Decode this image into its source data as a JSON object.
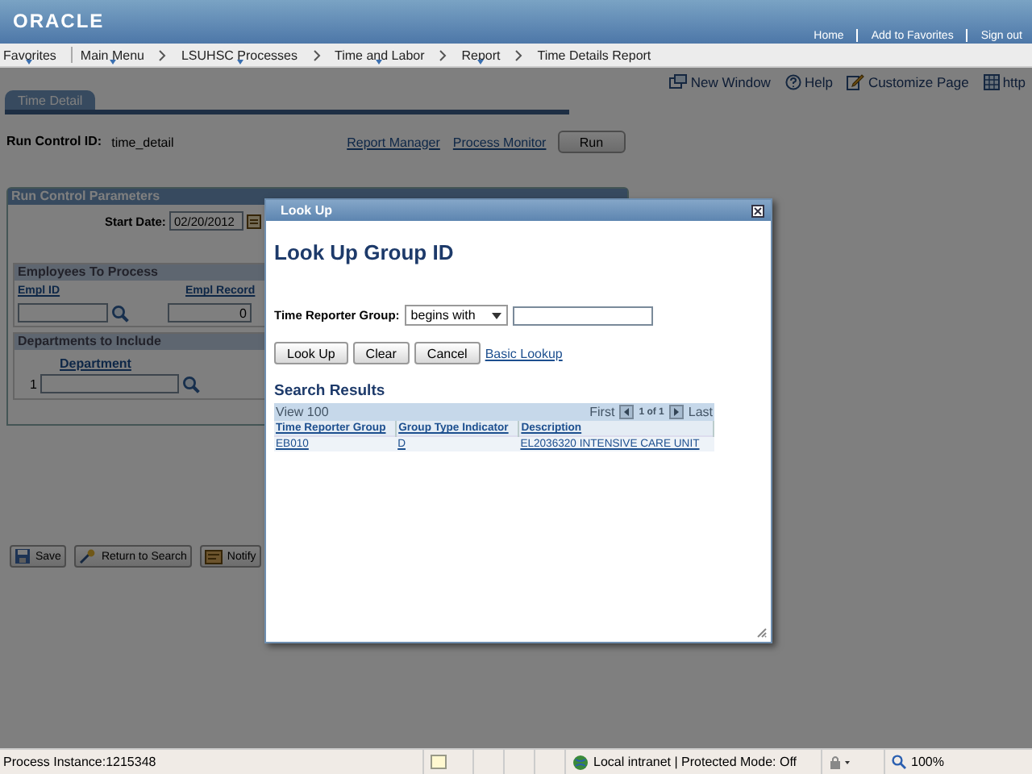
{
  "header": {
    "logo": "ORACLE",
    "links": [
      "Home",
      "Add to Favorites",
      "Sign out"
    ]
  },
  "breadcrumbs": [
    {
      "label": "Favorites",
      "menu": true
    },
    {
      "label": "Main Menu",
      "menu": true
    },
    {
      "label": "LSUHSC Processes",
      "menu": true
    },
    {
      "label": "Time and Labor",
      "menu": true
    },
    {
      "label": "Report",
      "menu": true
    },
    {
      "label": "Time Details Report",
      "menu": false
    }
  ],
  "page_toolbar": [
    {
      "kind": "new-window",
      "label": "New Window"
    },
    {
      "kind": "help",
      "label": "Help"
    },
    {
      "kind": "customize",
      "label": "Customize Page"
    },
    {
      "kind": "http",
      "label": "http"
    }
  ],
  "tabs": [
    {
      "label": "Time Detail",
      "selected": true
    }
  ],
  "run_control": {
    "label": "Run Control ID:",
    "value": "time_detail",
    "links": [
      "Report Manager",
      "Process Monitor"
    ],
    "button": "Run"
  },
  "parameters": {
    "title": "Run Control Parameters",
    "start_date": {
      "label": "Start Date:",
      "value": "02/20/2012"
    },
    "employees": {
      "title": "Employees To Process",
      "columns": [
        "Empl ID",
        "Empl Record"
      ],
      "empl_record": "0"
    },
    "departments": {
      "title": "Departments to Include",
      "column": "Department",
      "rows": [
        {
          "number": "1"
        }
      ]
    }
  },
  "actions": [
    {
      "kind": "save",
      "label": "Save"
    },
    {
      "kind": "return",
      "label": "Return to Search"
    },
    {
      "kind": "notify",
      "label": "Notify"
    }
  ],
  "lookup": {
    "title": "Look Up",
    "heading": "Look Up Group ID",
    "field_label": "Time Reporter Group:",
    "operator": "begins with",
    "buttons": [
      "Look Up",
      "Clear",
      "Cancel"
    ],
    "link": "Basic Lookup",
    "results_title": "Search Results",
    "view": "View 100",
    "first": "First",
    "pager": "1 of 1",
    "last": "Last",
    "columns": [
      "Time Reporter Group",
      "Group Type Indicator",
      "Description"
    ],
    "rows": [
      [
        "EB010",
        "D",
        "EL2036320 INTENSIVE CARE UNIT"
      ]
    ]
  },
  "status_bar": {
    "text": "Process Instance:1215348",
    "zone": "Local intranet | Protected Mode: Off",
    "zoom": "100%"
  }
}
